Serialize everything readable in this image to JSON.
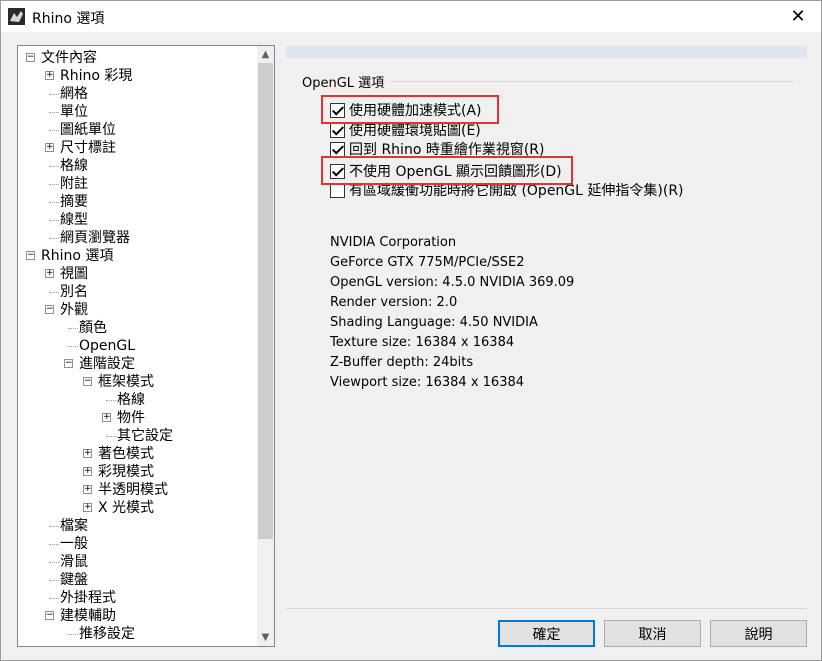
{
  "window": {
    "title": "Rhino 選項",
    "icon": "rhino-app-icon"
  },
  "tree": {
    "items": [
      {
        "label": "文件內容",
        "indent": 0,
        "expander": "−"
      },
      {
        "label": "Rhino 彩現",
        "indent": 1,
        "expander": "+"
      },
      {
        "label": "網格",
        "indent": 1,
        "expander": ""
      },
      {
        "label": "單位",
        "indent": 1,
        "expander": ""
      },
      {
        "label": "圖紙單位",
        "indent": 1,
        "expander": ""
      },
      {
        "label": "尺寸標註",
        "indent": 1,
        "expander": "+"
      },
      {
        "label": "格線",
        "indent": 1,
        "expander": ""
      },
      {
        "label": "附註",
        "indent": 1,
        "expander": ""
      },
      {
        "label": "摘要",
        "indent": 1,
        "expander": ""
      },
      {
        "label": "線型",
        "indent": 1,
        "expander": ""
      },
      {
        "label": "網頁瀏覽器",
        "indent": 1,
        "expander": ""
      },
      {
        "label": "Rhino 選項",
        "indent": 0,
        "expander": "−"
      },
      {
        "label": "視圖",
        "indent": 1,
        "expander": "+"
      },
      {
        "label": "別名",
        "indent": 1,
        "expander": ""
      },
      {
        "label": "外觀",
        "indent": 1,
        "expander": "−"
      },
      {
        "label": "顏色",
        "indent": 2,
        "expander": ""
      },
      {
        "label": "OpenGL",
        "indent": 2,
        "expander": ""
      },
      {
        "label": "進階設定",
        "indent": 2,
        "expander": "−"
      },
      {
        "label": "框架模式",
        "indent": 3,
        "expander": "−"
      },
      {
        "label": "格線",
        "indent": 4,
        "expander": ""
      },
      {
        "label": "物件",
        "indent": 4,
        "expander": "+"
      },
      {
        "label": "其它設定",
        "indent": 4,
        "expander": ""
      },
      {
        "label": "著色模式",
        "indent": 3,
        "expander": "+"
      },
      {
        "label": "彩現模式",
        "indent": 3,
        "expander": "+"
      },
      {
        "label": "半透明模式",
        "indent": 3,
        "expander": "+"
      },
      {
        "label": "X 光模式",
        "indent": 3,
        "expander": "+"
      },
      {
        "label": "檔案",
        "indent": 1,
        "expander": ""
      },
      {
        "label": "一般",
        "indent": 1,
        "expander": ""
      },
      {
        "label": "滑鼠",
        "indent": 1,
        "expander": ""
      },
      {
        "label": "鍵盤",
        "indent": 1,
        "expander": ""
      },
      {
        "label": "外掛程式",
        "indent": 1,
        "expander": ""
      },
      {
        "label": "建模輔助",
        "indent": 1,
        "expander": "−"
      },
      {
        "label": "推移設定",
        "indent": 2,
        "expander": ""
      }
    ]
  },
  "opengl": {
    "group_label": "OpenGL 選項",
    "options": [
      {
        "label": "使用硬體加速模式(A)",
        "checked": true,
        "highlighted": true
      },
      {
        "label": "使用硬體環境貼圖(E)",
        "checked": true,
        "highlighted": false
      },
      {
        "label": "回到 Rhino 時重繪作業視窗(R)",
        "checked": true,
        "highlighted": false
      },
      {
        "label": "不使用 OpenGL 顯示回饋圖形(D)",
        "checked": true,
        "highlighted": true
      },
      {
        "label": "有區域緩衝功能時將它開啟 (OpenGL 延伸指令集)(R)",
        "checked": false,
        "highlighted": false
      }
    ],
    "info": [
      "NVIDIA Corporation",
      "GeForce GTX 775M/PCIe/SSE2",
      "OpenGL version: 4.5.0 NVIDIA 369.09",
      "Render version: 2.0",
      "Shading Language: 4.50 NVIDIA",
      "Texture size: 16384 x 16384",
      "Z-Buffer depth: 24bits",
      "Viewport size: 16384 x 16384"
    ]
  },
  "buttons": {
    "ok": "確定",
    "cancel": "取消",
    "help": "說明"
  },
  "colors": {
    "highlight_box": "#e33434",
    "default_button_border": "#0078d7"
  }
}
